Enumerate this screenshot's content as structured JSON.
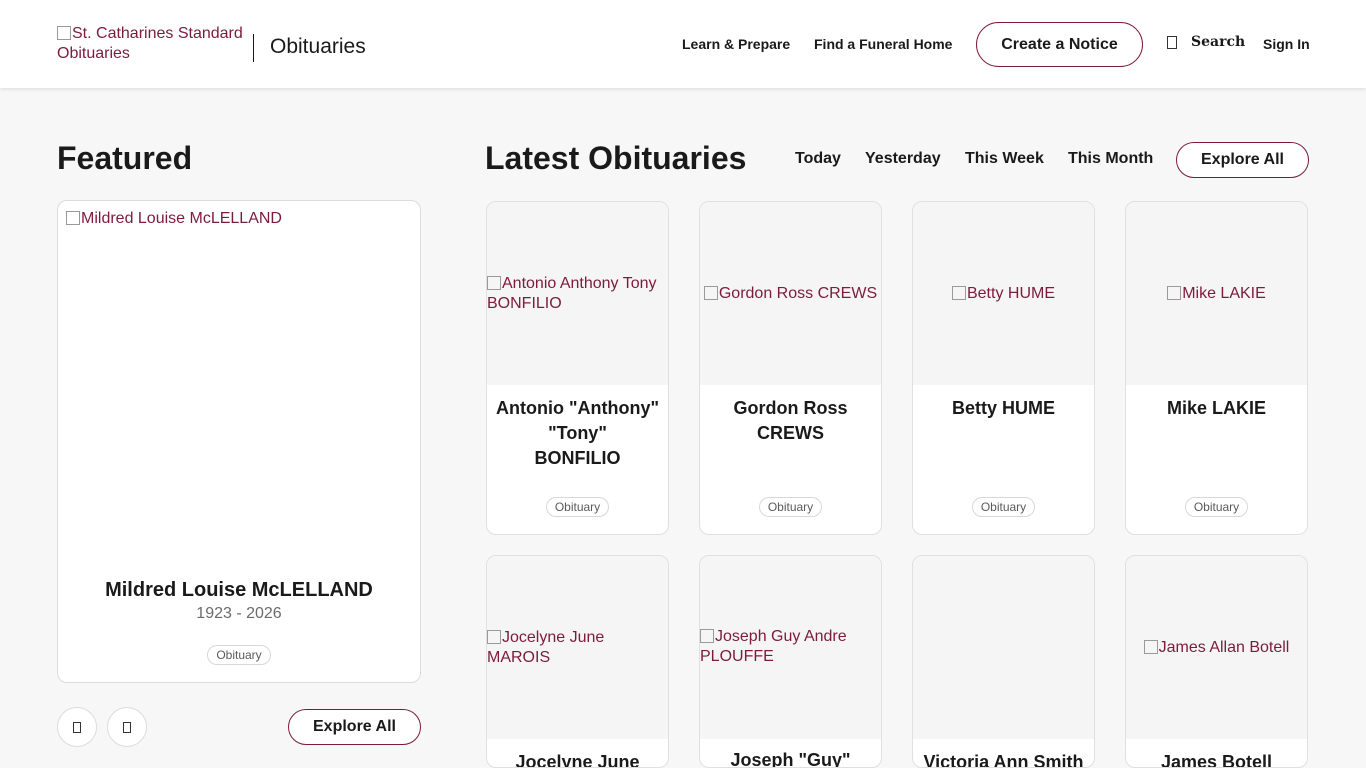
{
  "header": {
    "logo_alt": "St. Catharines Standard Obituaries",
    "brand": "Obituaries",
    "nav": {
      "learn": "Learn & Prepare",
      "find": "Find a Funeral Home",
      "create": "Create a Notice",
      "search": "Search",
      "sign_in": "Sign In"
    },
    "icons": {
      "search": "search-icon"
    }
  },
  "featured": {
    "title": "Featured",
    "image_alt": "Mildred Louise McLELLAND",
    "name": "Mildred Louise McLELLAND",
    "dates": "1923 - 2026",
    "tag": "Obituary",
    "explore": "Explore All",
    "controls": {
      "prev_icon": "chevron-left-icon",
      "next_icon": "chevron-right-icon"
    }
  },
  "latest": {
    "title": "Latest Obituaries",
    "filters": {
      "today": "Today",
      "yesterday": "Yesterday",
      "week": "This Week",
      "month": "This Month"
    },
    "explore": "Explore All",
    "cards": [
      {
        "image_alt": "Antonio Anthony Tony BONFILIO",
        "name_lines": [
          "Antonio \"Anthony\"",
          "\"Tony\"",
          "BONFILIO"
        ],
        "tag": "Obituary"
      },
      {
        "image_alt": "Gordon Ross CREWS",
        "name_lines": [
          "Gordon Ross",
          "CREWS"
        ],
        "tag": "Obituary"
      },
      {
        "image_alt": "Betty HUME",
        "name_lines": [
          "Betty HUME"
        ],
        "tag": "Obituary"
      },
      {
        "image_alt": "Mike LAKIE",
        "name_lines": [
          "Mike LAKIE"
        ],
        "tag": "Obituary"
      },
      {
        "image_alt": "Jocelyne June MAROIS",
        "name_lines": [
          "Jocelyne June"
        ]
      },
      {
        "image_alt": "Joseph Guy Andre PLOUFFE",
        "name_lines": [
          "Joseph \"Guy\""
        ]
      },
      {
        "image_alt": "",
        "name_lines": [
          "Victoria Ann Smith"
        ]
      },
      {
        "image_alt": "James Allan Botell",
        "name_lines": [
          "James Botell"
        ]
      }
    ]
  },
  "colors": {
    "accent": "#7b1c3b",
    "page_bg": "#f7f7f7",
    "text": "#1a1a1a"
  }
}
